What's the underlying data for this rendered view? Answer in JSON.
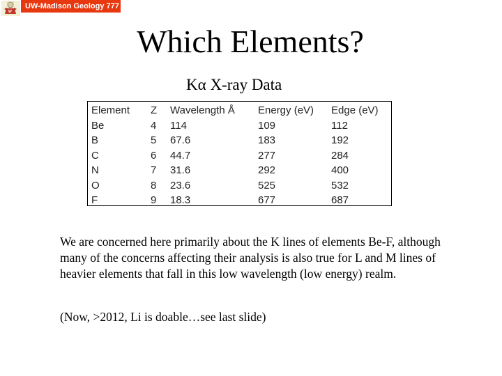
{
  "header": {
    "logo_icon": "badger-mascot-icon",
    "banner_text": "UW-Madison Geology  777",
    "banner_color": "#e8380f"
  },
  "slide": {
    "title": "Which Elements?",
    "subtitle_prefix": "K",
    "subtitle_alpha": "α",
    "subtitle_rest": " X-ray Data"
  },
  "table": {
    "headers": [
      "Element",
      "Z",
      "Wavelength Å",
      "Energy (eV)",
      "Edge (eV)"
    ],
    "rows": [
      {
        "element": "Be",
        "z": "4",
        "wavelength": "114",
        "energy": "109",
        "edge": "112"
      },
      {
        "element": "B",
        "z": "5",
        "wavelength": "67.6",
        "energy": "183",
        "edge": "192"
      },
      {
        "element": "C",
        "z": "6",
        "wavelength": "44.7",
        "energy": "277",
        "edge": "284"
      },
      {
        "element": "N",
        "z": "7",
        "wavelength": "31.6",
        "energy": "292",
        "edge": "400"
      },
      {
        "element": "O",
        "z": "8",
        "wavelength": "23.6",
        "energy": "525",
        "edge": "532"
      },
      {
        "element": "F",
        "z": "9",
        "wavelength": "18.3",
        "energy": "677",
        "edge": "687"
      }
    ]
  },
  "body": {
    "paragraph1": "We are concerned here primarily about the K lines of elements Be-F, although many of the concerns affecting their analysis is also true for L and M lines of heavier elements that fall in this low wavelength (low energy) realm.",
    "paragraph2": "(Now, >2012, Li is doable…see last slide)"
  }
}
